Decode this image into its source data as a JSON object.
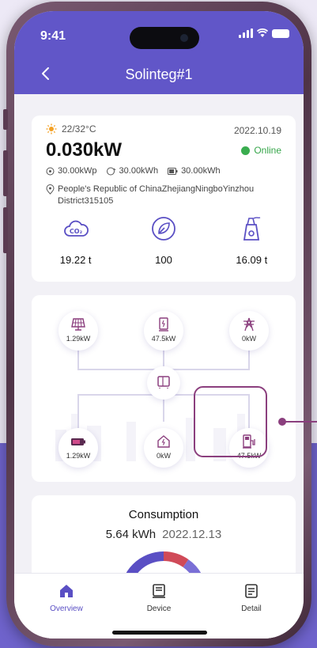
{
  "status": {
    "time": "9:41"
  },
  "header": {
    "title": "Solinteg#1"
  },
  "overview": {
    "temperature": "22/32°C",
    "date": "2022.10.19",
    "power": "0.030kW",
    "status": "Online",
    "stats": [
      "30.00kWp",
      "30.00kWh",
      "30.00kWh"
    ],
    "address": "People's Republic of ChinaZhejiangNingboYinzhou District315105",
    "metrics": [
      {
        "icon": "co2-cloud-icon",
        "value": "19.22 t"
      },
      {
        "icon": "leaf-icon",
        "value": "100"
      },
      {
        "icon": "factory-icon",
        "value": "16.09 t"
      }
    ]
  },
  "energy_flow": {
    "nodes": [
      {
        "icon": "solar-panel-icon",
        "value": "1.29kW"
      },
      {
        "icon": "inverter-unit-icon",
        "value": "47.5kW"
      },
      {
        "icon": "grid-tower-icon",
        "value": "0kW"
      },
      {
        "icon": "battery-icon",
        "value": "1.29kW"
      },
      {
        "icon": "home-load-icon",
        "value": "0kW"
      },
      {
        "icon": "ev-charger-icon",
        "value": "47.5kW"
      }
    ]
  },
  "consumption": {
    "title": "Consumption",
    "value": "5.64 kWh",
    "date": "2022.12.13"
  },
  "tabs": [
    {
      "label": "Overview",
      "icon": "home-icon",
      "active": true
    },
    {
      "label": "Device",
      "icon": "device-icon",
      "active": false
    },
    {
      "label": "Detail",
      "icon": "detail-icon",
      "active": false
    }
  ],
  "colors": {
    "header": "#6156c8",
    "accent": "#5a4fc4",
    "online": "#3aad4f",
    "highlight": "#8b3f7e",
    "background_violet": "#6f63cc"
  }
}
